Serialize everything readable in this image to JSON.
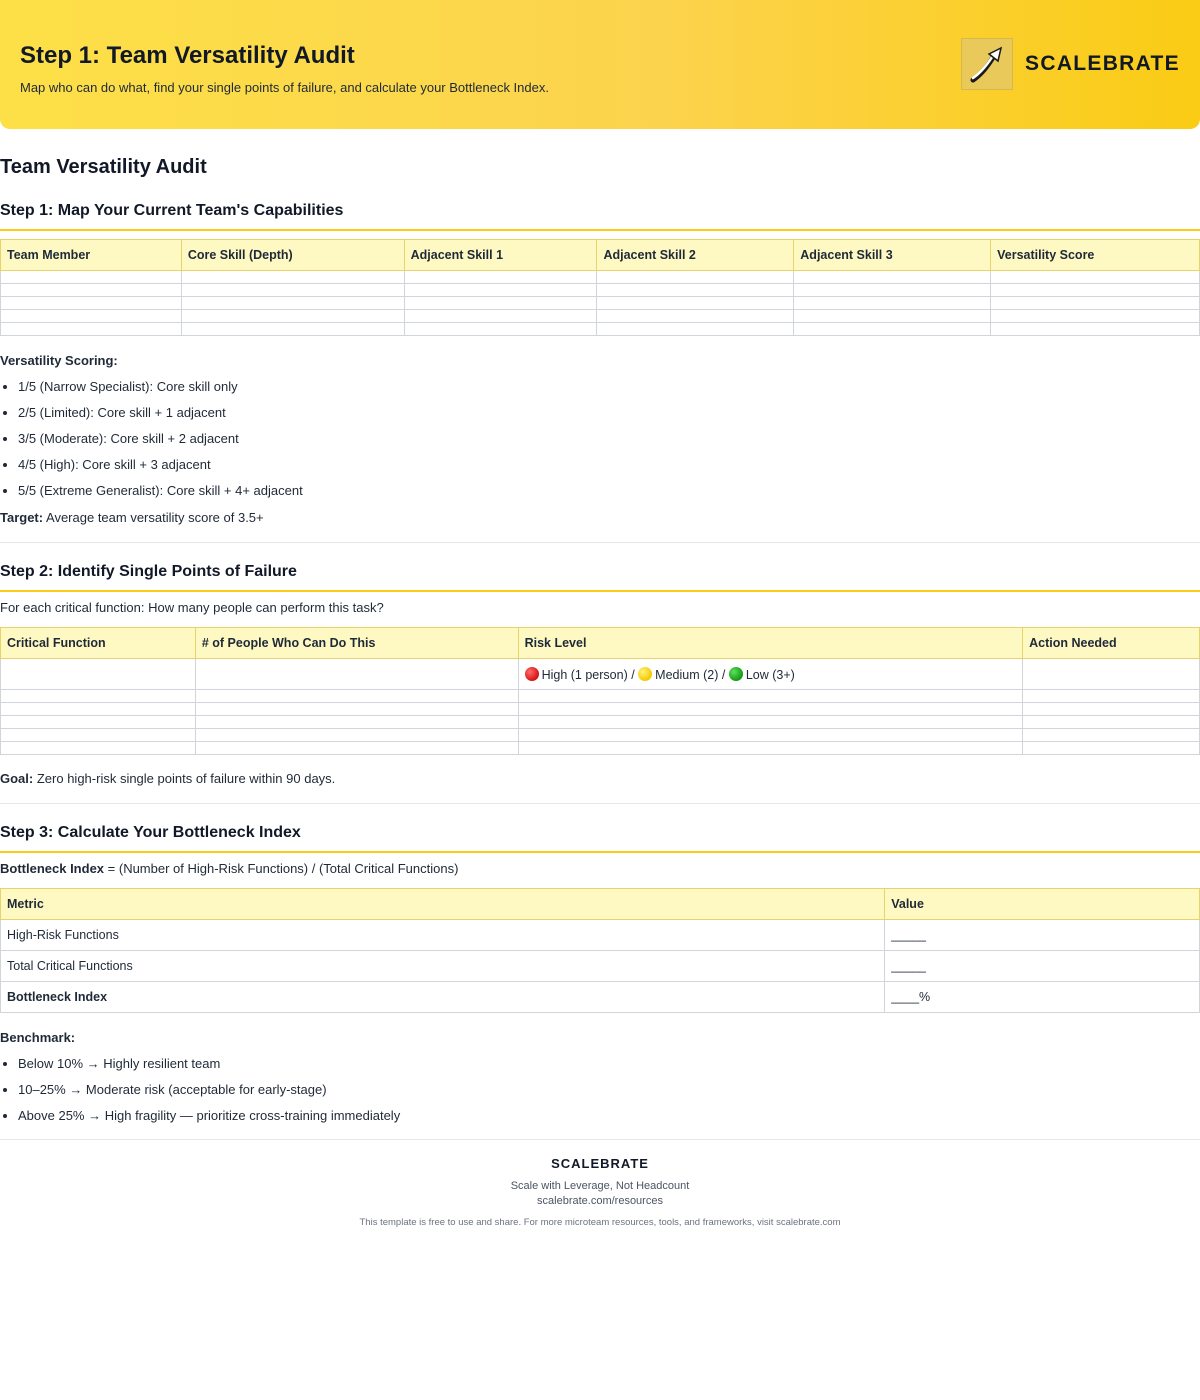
{
  "header": {
    "title": "Step 1: Team Versatility Audit",
    "subtitle": "Map who can do what, find your single points of failure, and calculate your Bottleneck Index.",
    "brand": "SCALEBRATE",
    "logo_icon": "rising-arrow-icon"
  },
  "doc_title": "Team Versatility Audit",
  "step1": {
    "heading": "Step 1: Map Your Current Team's Capabilities",
    "columns": [
      "Team Member",
      "Core Skill (Depth)",
      "Adjacent Skill 1",
      "Adjacent Skill 2",
      "Adjacent Skill 3",
      "Versatility Score"
    ],
    "scoring_label": "Versatility Scoring:",
    "scoring": [
      "1/5 (Narrow Specialist): Core skill only",
      "2/5 (Limited): Core skill + 1 adjacent",
      "3/5 (Moderate): Core skill + 2 adjacent",
      "4/5 (High): Core skill + 3 adjacent",
      "5/5 (Extreme Generalist): Core skill + 4+ adjacent"
    ],
    "target_label": "Target:",
    "target_text": "Average team versatility score of 3.5+"
  },
  "step2": {
    "heading": "Step 2: Identify Single Points of Failure",
    "intro": "For each critical function: How many people can perform this task?",
    "columns": [
      "Critical Function",
      "# of People Who Can Do This",
      "Risk Level",
      "Action Needed"
    ],
    "risk_high": "High (1 person) /",
    "risk_medium": "Medium (2) /",
    "risk_low": "Low (3+)",
    "goal_label": "Goal:",
    "goal_text": "Zero high-risk single points of failure within 90 days."
  },
  "step3": {
    "heading": "Step 3: Calculate Your Bottleneck Index",
    "formula_label": "Bottleneck Index",
    "formula_text": "= (Number of High-Risk Functions) / (Total Critical Functions)",
    "columns": [
      "Metric",
      "Value"
    ],
    "rows": [
      {
        "metric": "High-Risk Functions",
        "value": "_____"
      },
      {
        "metric": "Total Critical Functions",
        "value": "_____"
      },
      {
        "metric": "Bottleneck Index",
        "value": "____%"
      }
    ],
    "benchmark_label": "Benchmark:",
    "benchmarks": [
      "Below 10% → Highly resilient team",
      "10–25% → Moderate risk (acceptable for early-stage)",
      "Above 25% → High fragility — prioritize cross-training immediately"
    ]
  },
  "footer": {
    "brand": "SCALEBRATE",
    "tagline": "Scale with Leverage, Not Headcount",
    "url": "scalebrate.com/resources",
    "note": "This template is free to use and share. For more microteam resources, tools, and frameworks, visit scalebrate.com"
  }
}
